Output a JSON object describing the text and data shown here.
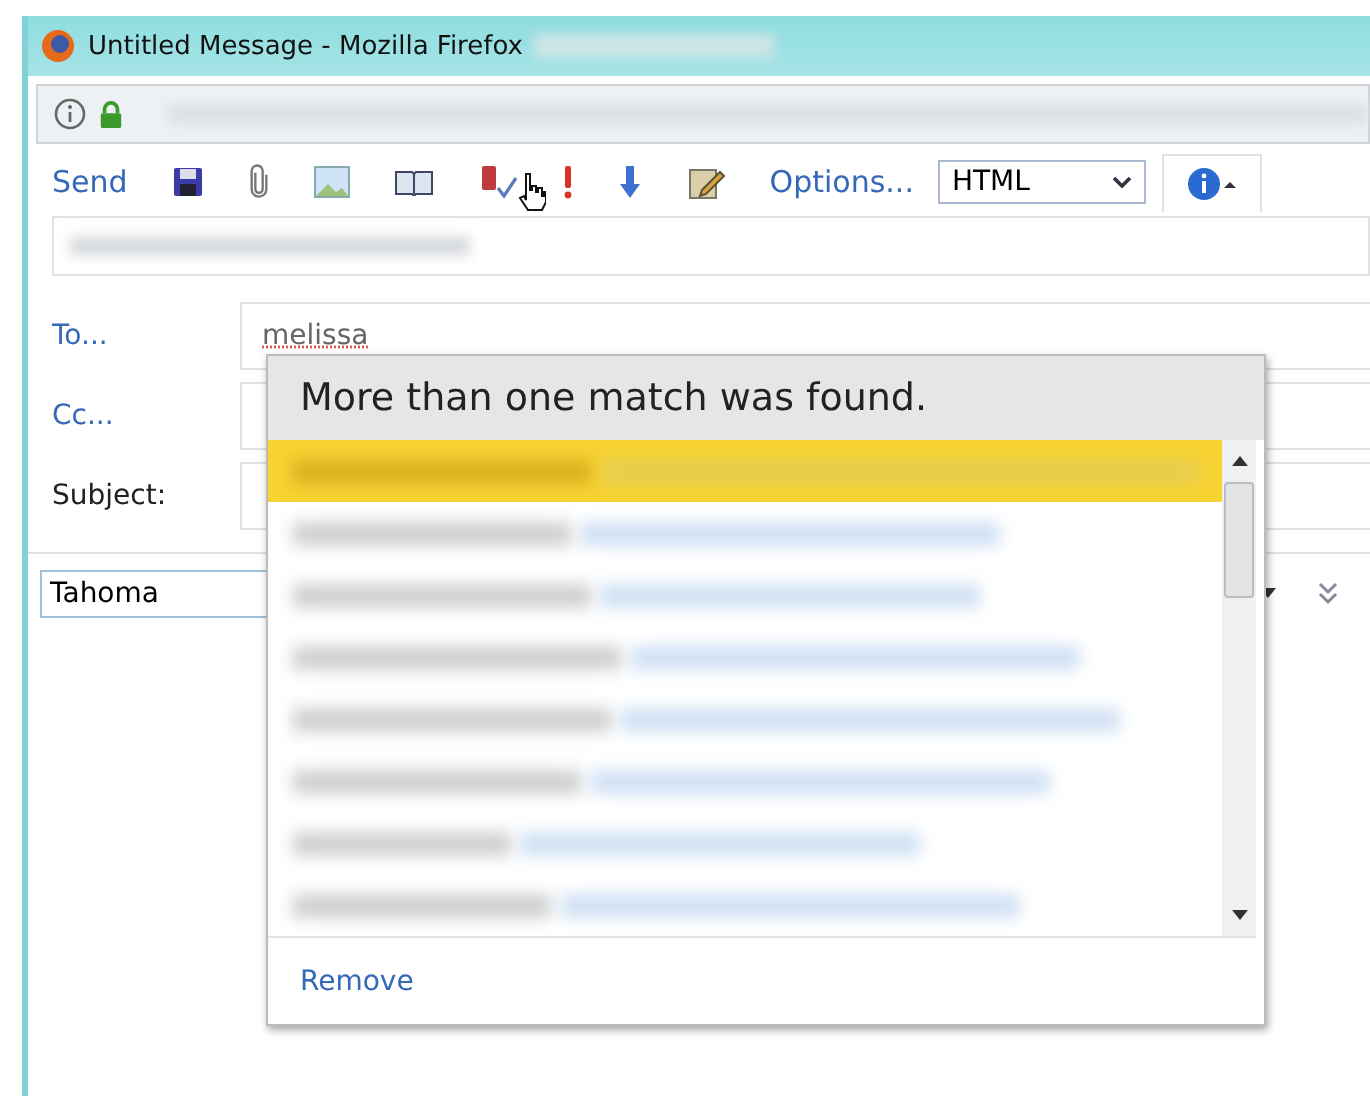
{
  "window": {
    "title": "Untitled Message - Mozilla Firefox"
  },
  "toolbar": {
    "send": "Send",
    "options": "Options...",
    "format": "HTML"
  },
  "fields": [
    {
      "kind": "link",
      "label": "To...",
      "value": "melissa"
    },
    {
      "kind": "link",
      "label": "Cc..."
    },
    {
      "kind": "plain",
      "label": "Subject:"
    }
  ],
  "font_select": {
    "value": "Tahoma"
  },
  "popup": {
    "title": "More than one match was found.",
    "remove": "Remove",
    "matches": [
      {
        "selected": true
      },
      {
        "selected": false
      },
      {
        "selected": false
      },
      {
        "selected": false
      },
      {
        "selected": false
      },
      {
        "selected": false
      },
      {
        "selected": false
      },
      {
        "selected": false
      }
    ]
  }
}
